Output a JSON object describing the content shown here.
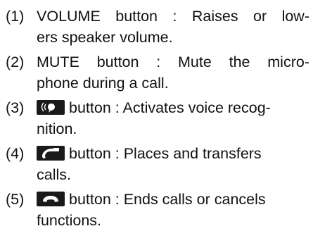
{
  "items": [
    {
      "num": "(1)",
      "line1": "VOLUME button : Raises or low-",
      "line2": "ers speaker volume."
    },
    {
      "num": "(2)",
      "line1": "MUTE button : Mute the micro-",
      "line2": "phone during a call."
    },
    {
      "num": "(3)",
      "icon": "voice-recognition-icon",
      "line1": "button : Activates voice recog-",
      "line2": "nition."
    },
    {
      "num": "(4)",
      "icon": "phone-call-icon",
      "line1": "button : Places and transfers",
      "line2": "calls."
    },
    {
      "num": "(5)",
      "icon": "phone-end-icon",
      "line1": "button : Ends calls or cancels",
      "line2": "functions."
    }
  ]
}
